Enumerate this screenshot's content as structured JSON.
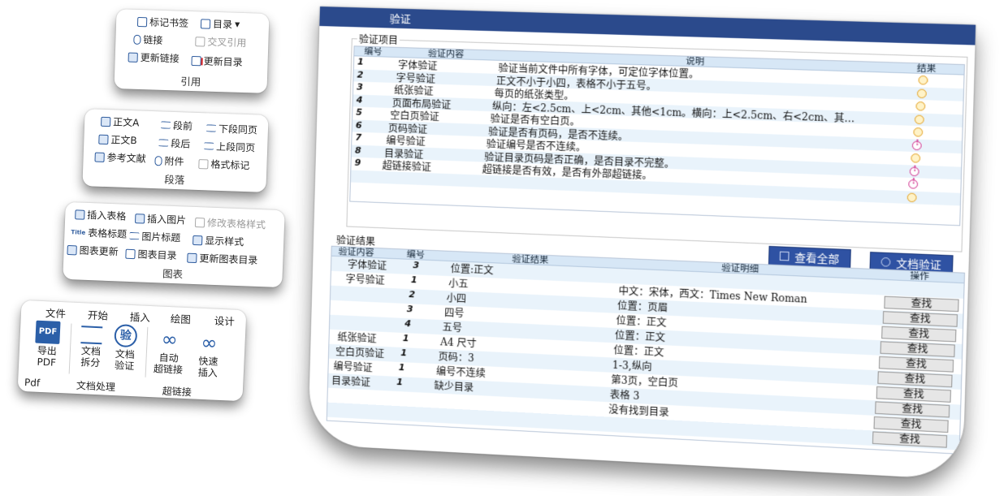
{
  "ribbon": {
    "cite": {
      "group": "引用",
      "bookmark": "标记书签",
      "toc": "目录",
      "link": "链接",
      "crossref": "交叉引用",
      "update_link": "更新链接",
      "update_toc": "更新目录"
    },
    "para": {
      "group": "段落",
      "body_a": "正文A",
      "before": "段前",
      "keep_next": "下段同页",
      "body_b": "正文B",
      "after": "段后",
      "keep_prev": "上段同页",
      "ref": "参考文献",
      "attach": "附件",
      "format_mark": "格式标记"
    },
    "chart": {
      "group": "图表",
      "insert_table": "插入表格",
      "insert_image": "插入图片",
      "modify_style": "修改表格样式",
      "table_title_tag": "Title",
      "table_title": "表格标题",
      "image_title": "图片标题",
      "show_style": "显示样式",
      "chart_update": "图表更新",
      "chart_toc": "图表目录",
      "update_chart_toc": "更新图表目录"
    },
    "tabs": [
      "文件",
      "开始",
      "插入",
      "绘图",
      "设计"
    ],
    "tools": {
      "pdf_icon": "PDF",
      "export_pdf": [
        "导出",
        "PDF"
      ],
      "split": [
        "文档",
        "拆分"
      ],
      "verify_icon": "验",
      "verify": [
        "文档",
        "验证"
      ],
      "auto_link": [
        "自动",
        "超链接"
      ],
      "quick_insert": [
        "快速",
        "插入"
      ],
      "groups": [
        "Pdf",
        "文档处理",
        "超链接"
      ]
    }
  },
  "window": {
    "title": "验证",
    "items_legend": "验证项目",
    "items_headers": [
      "编号",
      "验证内容",
      "说明",
      "结果"
    ],
    "items": [
      {
        "no": "1",
        "name": "字体验证",
        "desc": "验证当前文件中所有字体，可定位字体位置。",
        "status": "ok"
      },
      {
        "no": "2",
        "name": "字号验证",
        "desc": "正文不小于小四，表格不小于五号。",
        "status": "ok"
      },
      {
        "no": "3",
        "name": "纸张验证",
        "desc": "每页的纸张类型。",
        "status": "ok"
      },
      {
        "no": "4",
        "name": "页面布局验证",
        "desc": "纵向：左<2.5cm、上<2cm、其他<1cm。横向：上<2.5cm、右<2cm、其…",
        "status": "ok"
      },
      {
        "no": "5",
        "name": "空白页验证",
        "desc": "验证是否有空白页。",
        "status": "ok"
      },
      {
        "no": "6",
        "name": "页码验证",
        "desc": "验证是否有页码，是否不连续。",
        "status": "error"
      },
      {
        "no": "7",
        "name": "编号验证",
        "desc": "验证编号是否不连续。",
        "status": "ok"
      },
      {
        "no": "8",
        "name": "目录验证",
        "desc": "验证目录页码是否正确，是否目录不完整。",
        "status": "error"
      },
      {
        "no": "9",
        "name": "超链接验证",
        "desc": "超链接是否有效，是否有外部超链接。",
        "status": "error"
      },
      {
        "no": "",
        "name": "",
        "desc": "",
        "status": "ok"
      }
    ],
    "view_all": "查看全部",
    "verify_doc": "文档验证",
    "results_legend": "验证结果",
    "results_headers": [
      "验证内容",
      "编号",
      "验证结果",
      "验证明细",
      "操作"
    ],
    "results": [
      {
        "name": "字体验证",
        "no": "3",
        "result": "位置:正文",
        "detail": "",
        "find": ""
      },
      {
        "name": "字号验证",
        "no": "1",
        "result": "小五",
        "detail": "中文：宋体，西文：Times New Roman",
        "find": "查找"
      },
      {
        "name": "",
        "no": "2",
        "result": "小四",
        "detail": "位置：页眉",
        "find": "查找"
      },
      {
        "name": "",
        "no": "3",
        "result": "四号",
        "detail": "位置：正文",
        "find": "查找"
      },
      {
        "name": "",
        "no": "4",
        "result": "五号",
        "detail": "位置：正文",
        "find": "查找"
      },
      {
        "name": "纸张验证",
        "no": "1",
        "result": "A4 尺寸",
        "detail": "位置：正文",
        "find": "查找"
      },
      {
        "name": "空白页验证",
        "no": "1",
        "result": "页码：3",
        "detail": "1-3,纵向",
        "find": "查找"
      },
      {
        "name": "编号验证",
        "no": "1",
        "result": "编号不连续",
        "detail": "第3页，空白页",
        "find": "查找"
      },
      {
        "name": "目录验证",
        "no": "1",
        "result": "缺少目录",
        "detail": "表格 3",
        "find": "查找"
      },
      {
        "name": "",
        "no": "",
        "result": "",
        "detail": "没有找到目录",
        "find": "查找"
      },
      {
        "name": "",
        "no": "",
        "result": "",
        "detail": "",
        "find": "查找"
      }
    ],
    "colors": {
      "titlebar": "#2b4a8c",
      "button": "#2f52a3",
      "header": "#d7e7f6",
      "alt_row": "#e9f3fb"
    }
  }
}
